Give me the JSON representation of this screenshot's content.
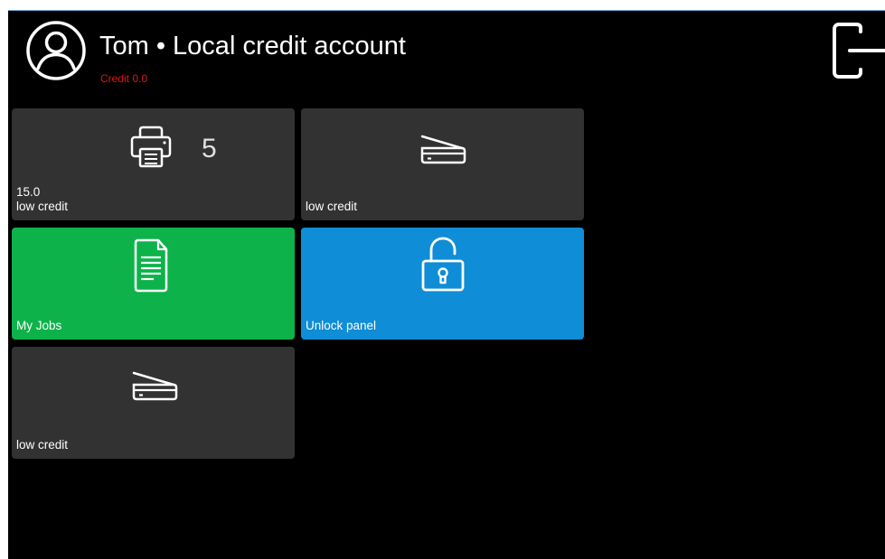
{
  "header": {
    "title": "Tom • Local credit account",
    "credit": "Credit 0.0",
    "avatar_icon": "user-circle-icon",
    "logout_icon": "logout-icon"
  },
  "tiles": [
    {
      "name": "print",
      "icon": "printer-icon",
      "count": "5",
      "value": "15.0",
      "status": "low credit"
    },
    {
      "name": "scan",
      "icon": "scanner-icon",
      "status": "low credit"
    },
    {
      "name": "my-jobs",
      "icon": "document-icon",
      "label": "My Jobs",
      "color": "#0db34a"
    },
    {
      "name": "unlock-panel",
      "icon": "unlock-icon",
      "label": "Unlock panel",
      "color": "#0f8dd6"
    },
    {
      "name": "scan-2",
      "icon": "scanner-icon",
      "status": "low credit"
    }
  ],
  "colors": {
    "background": "#000000",
    "tile": "#323232",
    "credit_text": "#e0161b"
  }
}
